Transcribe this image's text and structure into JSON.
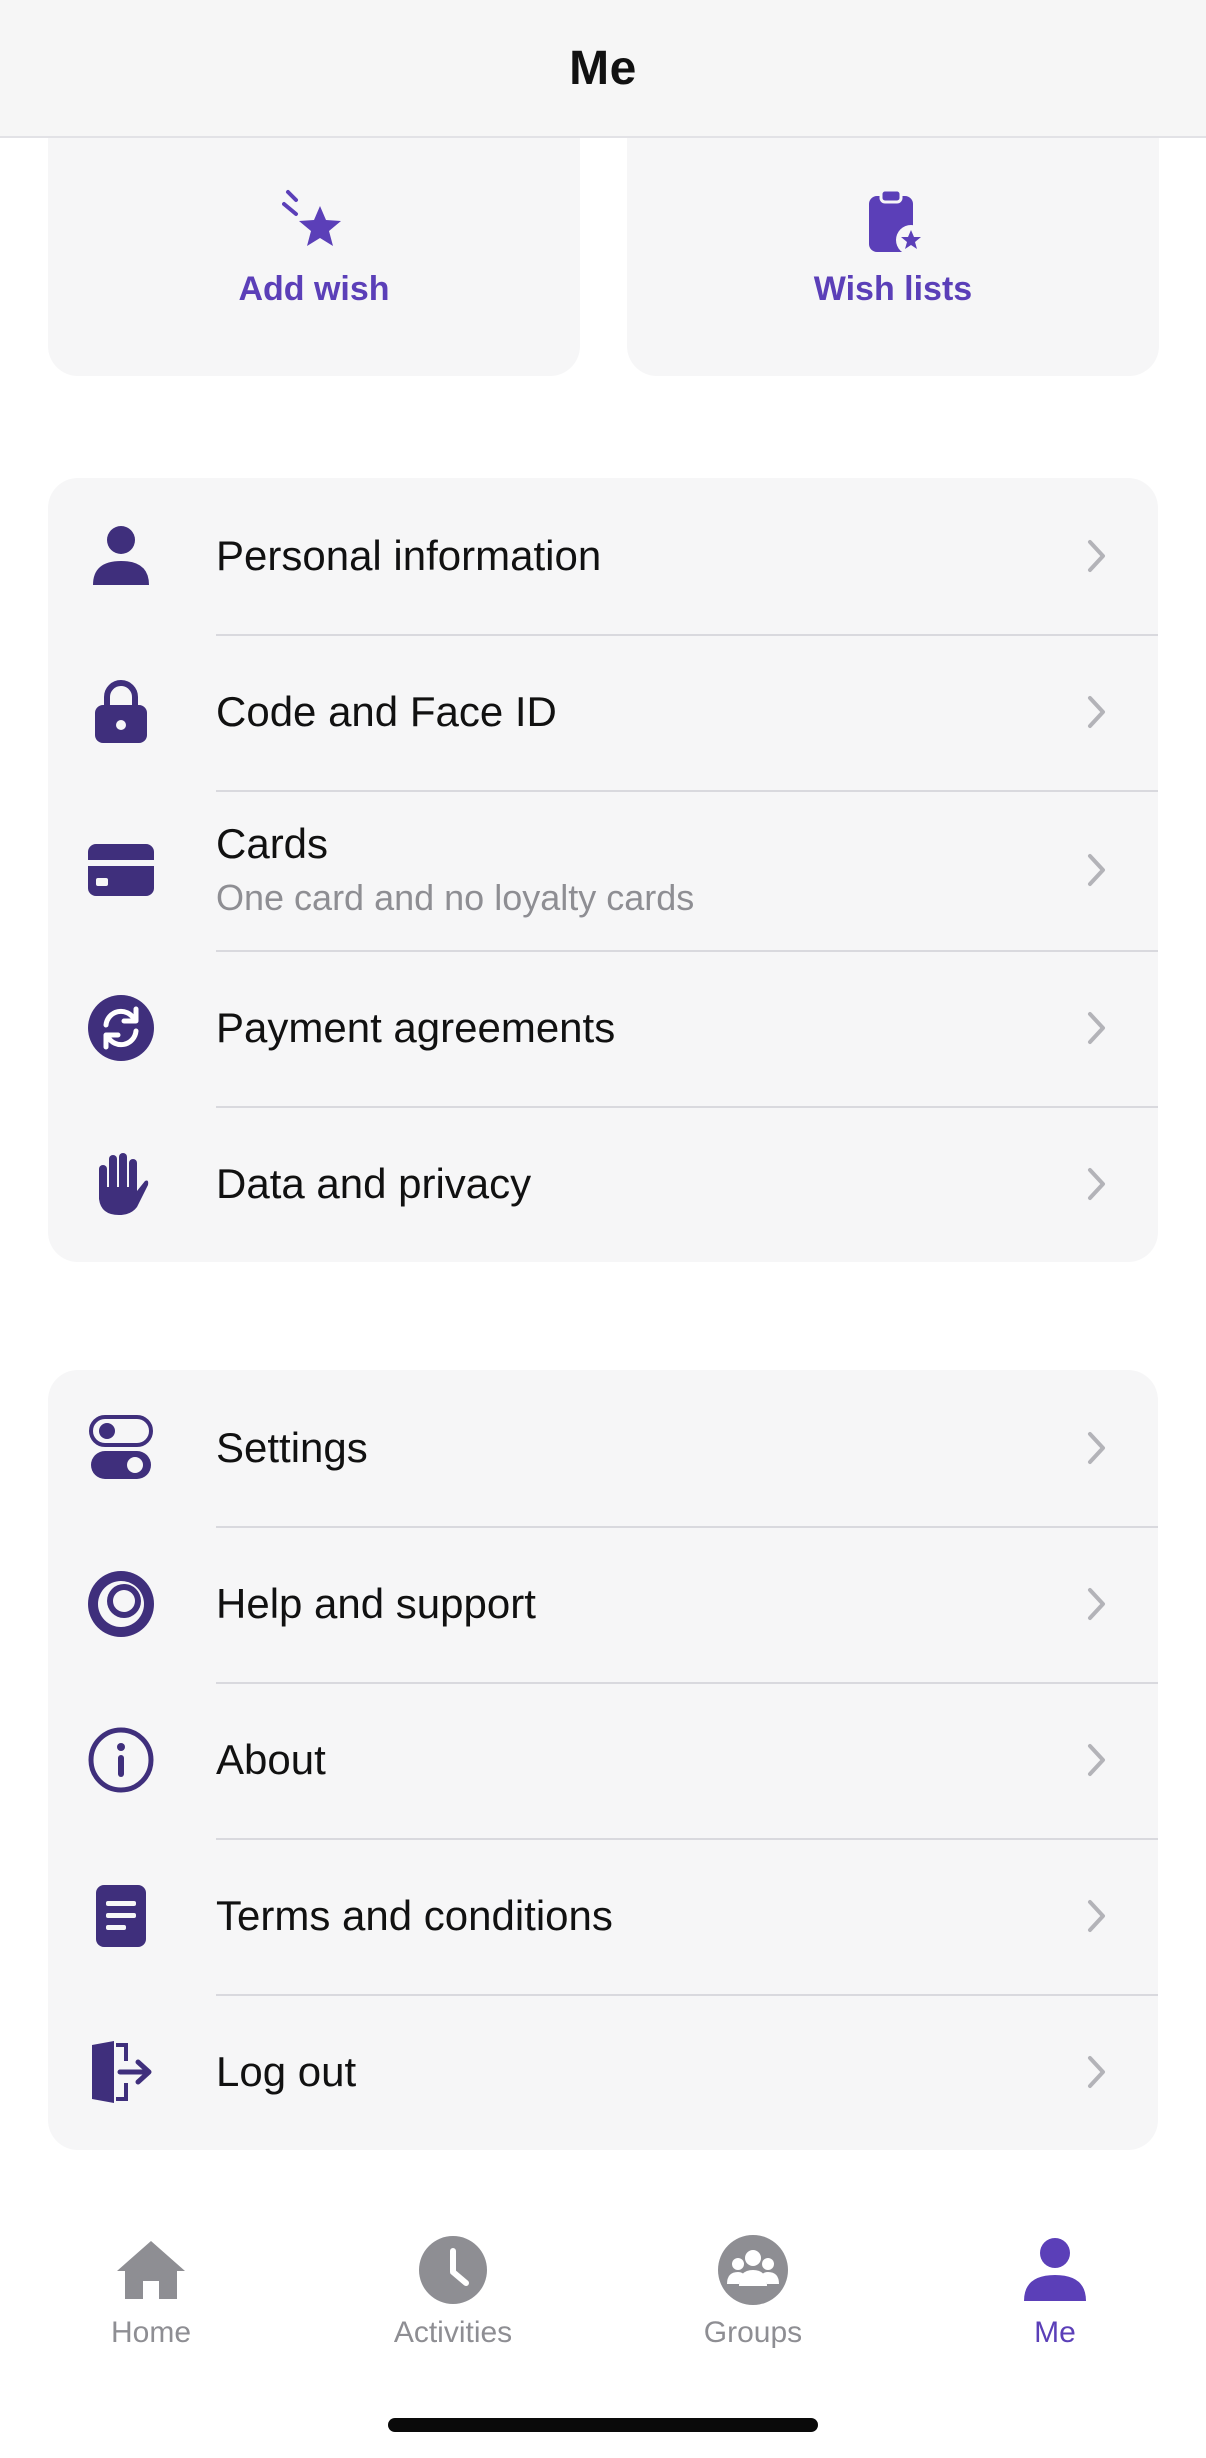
{
  "header": {
    "title": "Me"
  },
  "tiles": [
    {
      "label": "Add wish",
      "icon": "star-sparkle-icon"
    },
    {
      "label": "Wish lists",
      "icon": "clipboard-star-icon"
    }
  ],
  "account_section": {
    "items": [
      {
        "label": "Personal information",
        "icon": "person-icon"
      },
      {
        "label": "Code and Face ID",
        "icon": "lock-icon"
      },
      {
        "label": "Cards",
        "sublabel": "One card and no loyalty cards",
        "icon": "credit-card-icon"
      },
      {
        "label": "Payment agreements",
        "icon": "recurring-payment-icon"
      },
      {
        "label": "Data and privacy",
        "icon": "hand-icon"
      }
    ]
  },
  "app_section": {
    "items": [
      {
        "label": "Settings",
        "icon": "toggle-icon"
      },
      {
        "label": "Help and support",
        "icon": "lifebuoy-icon"
      },
      {
        "label": "About",
        "icon": "info-icon"
      },
      {
        "label": "Terms and conditions",
        "icon": "document-icon"
      },
      {
        "label": "Log out",
        "icon": "logout-door-icon"
      }
    ]
  },
  "tabbar": {
    "tabs": [
      {
        "label": "Home",
        "icon": "home-icon",
        "active": false
      },
      {
        "label": "Activities",
        "icon": "clock-icon",
        "active": false
      },
      {
        "label": "Groups",
        "icon": "groups-icon",
        "active": false
      },
      {
        "label": "Me",
        "icon": "person-icon",
        "active": true
      }
    ]
  },
  "colors": {
    "accent": "#5b3fb8",
    "icon_dark": "#3f2f7c",
    "inactive": "#8e8e93",
    "card_bg": "#f6f6f7",
    "chevron": "#b3b3b8"
  }
}
